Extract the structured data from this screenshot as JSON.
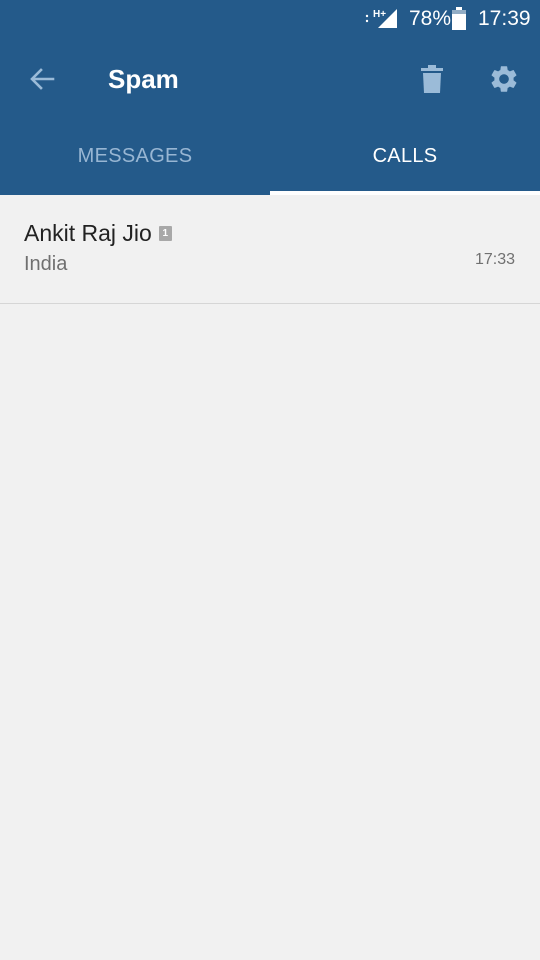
{
  "status_bar": {
    "network_label": "H+",
    "battery_percent": "78%",
    "time": "17:39"
  },
  "toolbar": {
    "title": "Spam",
    "back_icon": "arrow-left-icon",
    "trash_icon": "trash-icon",
    "settings_icon": "gear-icon"
  },
  "tabs": [
    {
      "label": "MESSAGES",
      "active": false
    },
    {
      "label": "CALLS",
      "active": true
    }
  ],
  "calls": [
    {
      "name": "Ankit Raj Jio",
      "sim_badge": "1",
      "location": "India",
      "time": "17:33"
    }
  ],
  "colors": {
    "appbar": "#245a8a",
    "background": "#f1f1f1",
    "tab_inactive": "#98b6d3",
    "tab_active": "#ffffff"
  }
}
